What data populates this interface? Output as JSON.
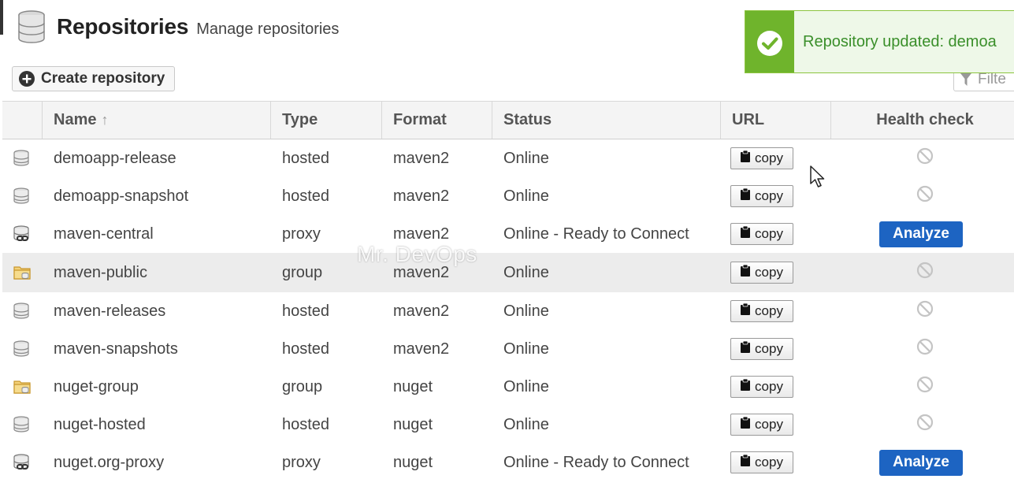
{
  "header": {
    "title": "Repositories",
    "subtitle": "Manage repositories"
  },
  "toolbar": {
    "create_label": "Create repository",
    "filter_placeholder": "Filte"
  },
  "toast": {
    "message": "Repository updated: demoa"
  },
  "columns": {
    "name": "Name",
    "type": "Type",
    "format": "Format",
    "status": "Status",
    "url": "URL",
    "health": "Health check",
    "sort_indicator": "↑"
  },
  "copy_label": "copy",
  "analyze_label": "Analyze",
  "watermark": "Mr. DevOps",
  "rows": [
    {
      "name": "demoapp-release",
      "type": "hosted",
      "format": "maven2",
      "status": "Online",
      "icon": "database-icon",
      "health": "disabled-icon"
    },
    {
      "name": "demoapp-snapshot",
      "type": "hosted",
      "format": "maven2",
      "status": "Online",
      "icon": "database-icon",
      "health": "disabled-icon"
    },
    {
      "name": "maven-central",
      "type": "proxy",
      "format": "maven2",
      "status": "Online - Ready to Connect",
      "icon": "proxy-database-icon",
      "health": "analyze-button"
    },
    {
      "name": "maven-public",
      "type": "group",
      "format": "maven2",
      "status": "Online",
      "icon": "folder-group-icon",
      "health": "disabled-icon"
    },
    {
      "name": "maven-releases",
      "type": "hosted",
      "format": "maven2",
      "status": "Online",
      "icon": "database-icon",
      "health": "disabled-icon"
    },
    {
      "name": "maven-snapshots",
      "type": "hosted",
      "format": "maven2",
      "status": "Online",
      "icon": "database-icon",
      "health": "disabled-icon"
    },
    {
      "name": "nuget-group",
      "type": "group",
      "format": "nuget",
      "status": "Online",
      "icon": "folder-group-icon",
      "health": "disabled-icon"
    },
    {
      "name": "nuget-hosted",
      "type": "hosted",
      "format": "nuget",
      "status": "Online",
      "icon": "database-icon",
      "health": "disabled-icon"
    },
    {
      "name": "nuget.org-proxy",
      "type": "proxy",
      "format": "nuget",
      "status": "Online - Ready to Connect",
      "icon": "proxy-database-icon",
      "health": "analyze-button"
    }
  ],
  "colors": {
    "accent_blue": "#1d64c2",
    "toast_green": "#6fb42c",
    "toast_text": "#3a8f2a",
    "folder_yellow": "#e9b949"
  }
}
